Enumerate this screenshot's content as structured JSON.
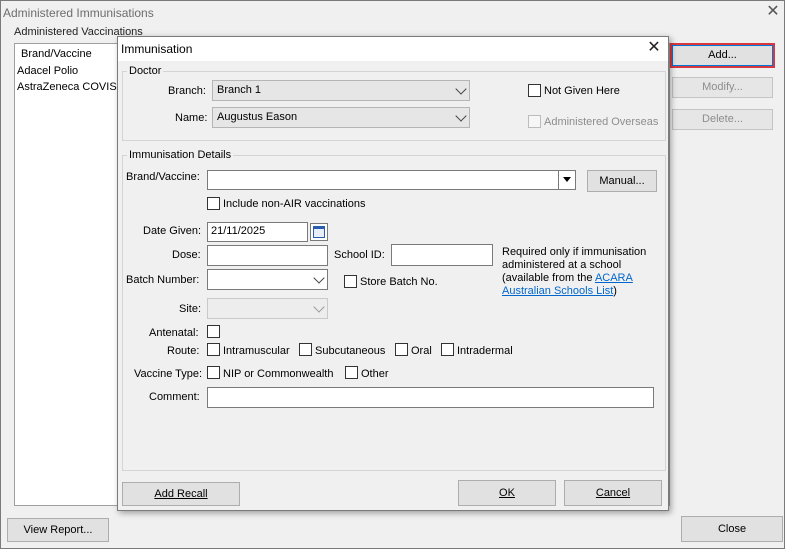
{
  "window": {
    "title": "Administered Immunisations",
    "close_glyph": "✕"
  },
  "list": {
    "group_label": "Administered Vaccinations",
    "rows": [
      "Brand/Vaccine",
      "Adacel Polio",
      "AstraZeneca COVISH"
    ]
  },
  "side_buttons": {
    "add": "Add...",
    "modify": "Modify...",
    "delete": "Delete..."
  },
  "footer": {
    "view_report": "View Report...",
    "close": "Close"
  },
  "dialog": {
    "title": "Immunisation",
    "close_glyph": "✕",
    "doctor": {
      "legend": "Doctor",
      "branch_label": "Branch:",
      "branch_value": "Branch 1",
      "name_label": "Name:",
      "name_value": "Augustus Eason",
      "not_given_here": "Not Given Here",
      "administered_overseas": "Administered Overseas"
    },
    "details": {
      "legend": "Immunisation Details",
      "brand_label": "Brand/Vaccine:",
      "brand_value": "",
      "manual_button": "Manual...",
      "include_non_air": "Include non-AIR vaccinations",
      "date_label": "Date Given:",
      "date_value": "21/11/2025",
      "dose_label": "Dose:",
      "dose_value": "",
      "school_id_label": "School ID:",
      "school_id_value": "",
      "school_note_1": "Required only if immunisation",
      "school_note_2": "administered at a school",
      "school_note_3": "(available from the ",
      "school_link_1": "ACARA",
      "school_link_2": "Australian Schools List",
      "school_note_end": ")",
      "batch_label": "Batch Number:",
      "batch_value": "",
      "store_batch": "Store Batch No.",
      "site_label": "Site:",
      "site_value": "",
      "antenatal_label": "Antenatal:",
      "route_label": "Route:",
      "route_options": [
        "Intramuscular",
        "Subcutaneous",
        "Oral",
        "Intradermal"
      ],
      "vaccine_type_label": "Vaccine Type:",
      "vaccine_types": [
        "NIP or Commonwealth",
        "Other"
      ],
      "comment_label": "Comment:",
      "comment_value": ""
    },
    "buttons": {
      "add_recall": "Add Recall",
      "ok": "OK",
      "cancel": "Cancel"
    }
  },
  "colors": {
    "highlight": "#d9383f",
    "link": "#0066cc",
    "background": "#f0f0f0"
  }
}
